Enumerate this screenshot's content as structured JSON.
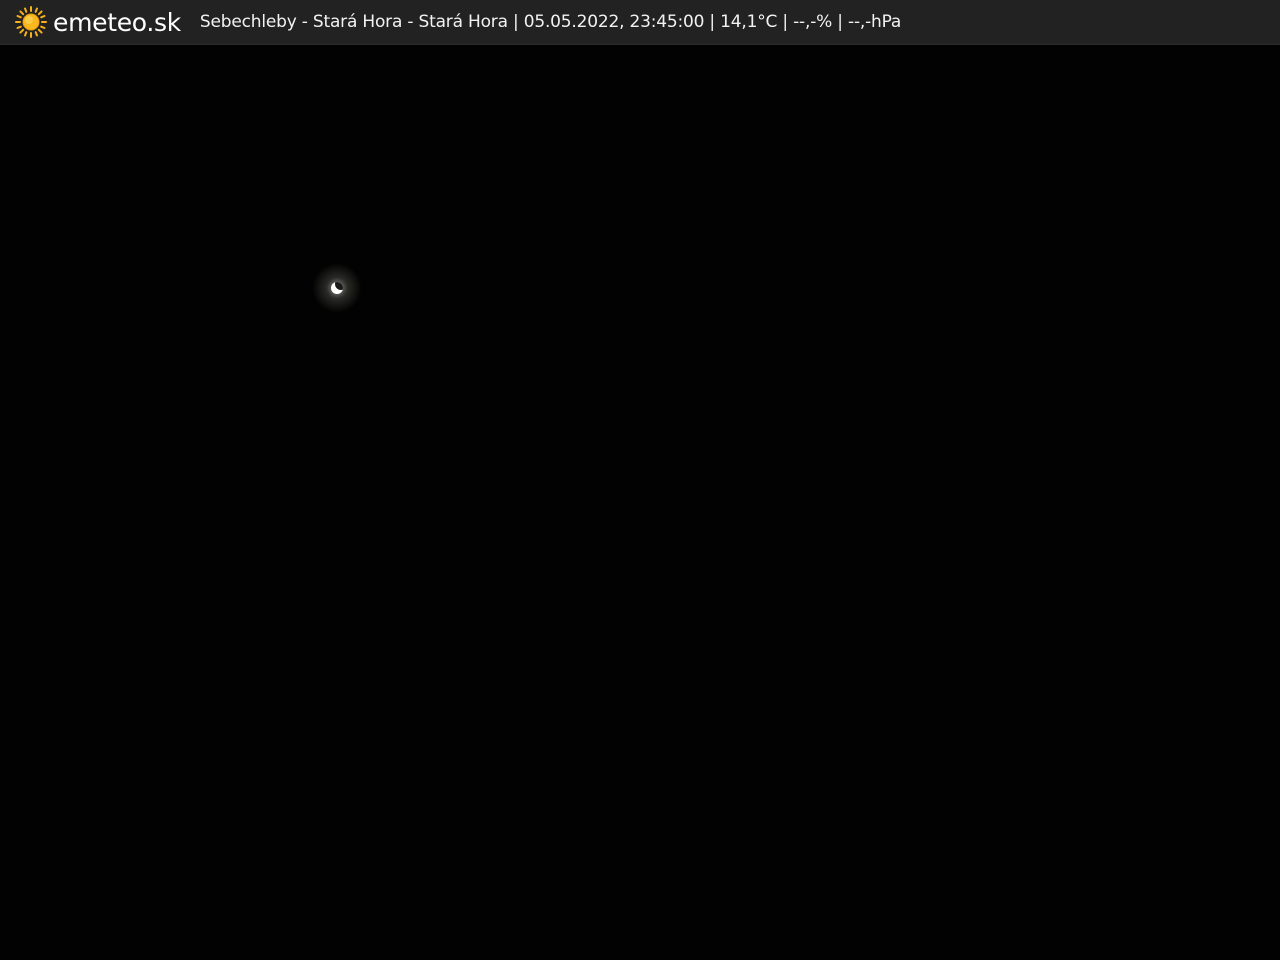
{
  "header": {
    "brand": "emeteo.sk",
    "caption": "Sebechleby - Stará Hora - Stará Hora | 05.05.2022, 23:45:00 | 14,1°C | --,-% | --,-hPa",
    "logo_icon": "sun-icon",
    "background_color": "#222222",
    "text_color": "#ffffff",
    "sun_color": "#f5b21b"
  },
  "scene": {
    "background_color": "#020202",
    "moon_icon": "crescent-moon"
  }
}
